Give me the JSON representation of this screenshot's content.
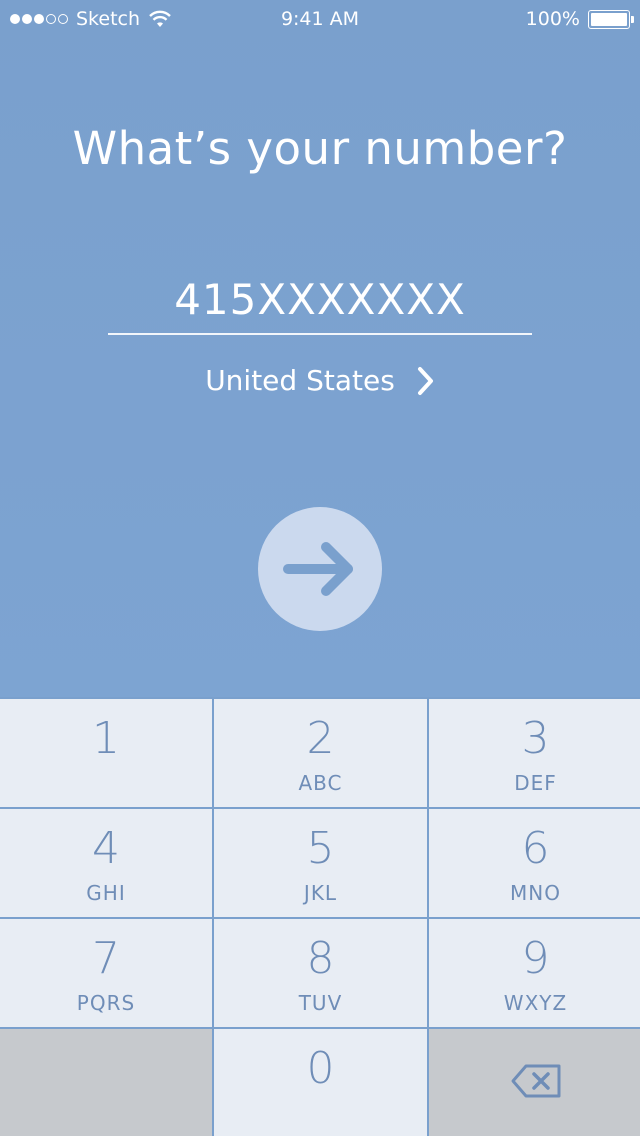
{
  "status_bar": {
    "carrier": "Sketch",
    "time": "9:41 AM",
    "battery": "100%",
    "signal_dots_full": 3,
    "signal_dots_empty": 2
  },
  "main": {
    "heading": "What’s your number?",
    "phone_value": "415XXXXXXX",
    "country": "United States",
    "next_icon": "arrow-right-icon"
  },
  "keypad": {
    "keys": [
      {
        "digit": "1",
        "letters": ""
      },
      {
        "digit": "2",
        "letters": "ABC"
      },
      {
        "digit": "3",
        "letters": "DEF"
      },
      {
        "digit": "4",
        "letters": "GHI"
      },
      {
        "digit": "5",
        "letters": "JKL"
      },
      {
        "digit": "6",
        "letters": "MNO"
      },
      {
        "digit": "7",
        "letters": "PQRS"
      },
      {
        "digit": "8",
        "letters": "TUV"
      },
      {
        "digit": "9",
        "letters": "WXYZ"
      },
      {
        "digit": "0",
        "letters": ""
      }
    ],
    "delete_icon": "backspace-icon"
  },
  "colors": {
    "background": "#7aa0cd",
    "key_bg": "#e8edf4",
    "key_text": "#6f8db7",
    "gray_key": "#c6c9cd",
    "button_circle": "#cbd9ee"
  }
}
